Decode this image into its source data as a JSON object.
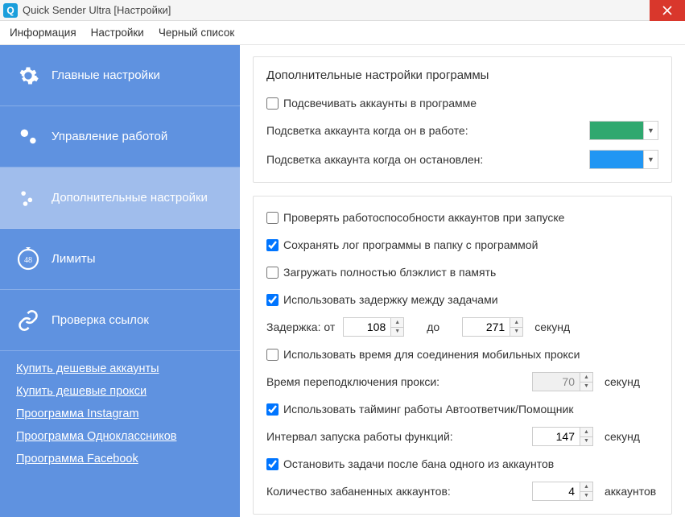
{
  "window": {
    "title": "Quick Sender Ultra [Настройки]",
    "app_icon_letter": "Q"
  },
  "menu": {
    "info": "Информация",
    "settings": "Настройки",
    "blacklist": "Черный список"
  },
  "sidebar": {
    "items": [
      {
        "label": "Главные настройки"
      },
      {
        "label": "Управление работой"
      },
      {
        "label": "Дополнительные настройки"
      },
      {
        "label": "Лимиты",
        "badge": "48"
      },
      {
        "label": "Проверка ссылок"
      }
    ],
    "active_index": 2,
    "links": [
      "Купить дешевые аккаунты",
      "Купить дешевые прокси",
      "Проограмма Instagram",
      "Проограмма Одноклассников",
      "Проограмма Facebook"
    ]
  },
  "panel1": {
    "title": "Дополнительные настройки программы",
    "highlight_accounts": {
      "label": "Подсвечивать аккаунты в программе",
      "checked": false
    },
    "color_working": {
      "label": "Подсветка аккаунта когда он в работе:",
      "color": "#2fa86f"
    },
    "color_stopped": {
      "label": "Подсветка аккаунта когда он остановлен:",
      "color": "#2196f3"
    }
  },
  "panel2": {
    "check_on_start": {
      "label": "Проверять работоспособности аккаунтов при запуске",
      "checked": false
    },
    "save_log": {
      "label": "Сохранять лог программы в папку с программой",
      "checked": true
    },
    "load_blacklist": {
      "label": "Загружать полностью блэклист в память",
      "checked": false
    },
    "use_delay": {
      "label": "Использовать задержку между задачами",
      "checked": true
    },
    "delay": {
      "label_from": "Задержка: от",
      "value_from": "108",
      "label_to": "до",
      "value_to": "271",
      "unit": "секунд"
    },
    "use_mobile_time": {
      "label": "Использовать время для соединения мобильных прокси",
      "checked": false
    },
    "reconnect": {
      "label": "Время переподключения прокси:",
      "value": "70",
      "unit": "секунд",
      "disabled": true
    },
    "use_timing": {
      "label": "Использовать тайминг работы Автоответчик/Помощник",
      "checked": true
    },
    "interval": {
      "label": "Интервал запуска работы функций:",
      "value": "147",
      "unit": "секунд"
    },
    "stop_on_ban": {
      "label": "Остановить задачи после бана одного из аккаунтов",
      "checked": true
    },
    "banned_count": {
      "label": "Количество забаненных аккаунтов:",
      "value": "4",
      "unit": "аккаунтов"
    }
  }
}
